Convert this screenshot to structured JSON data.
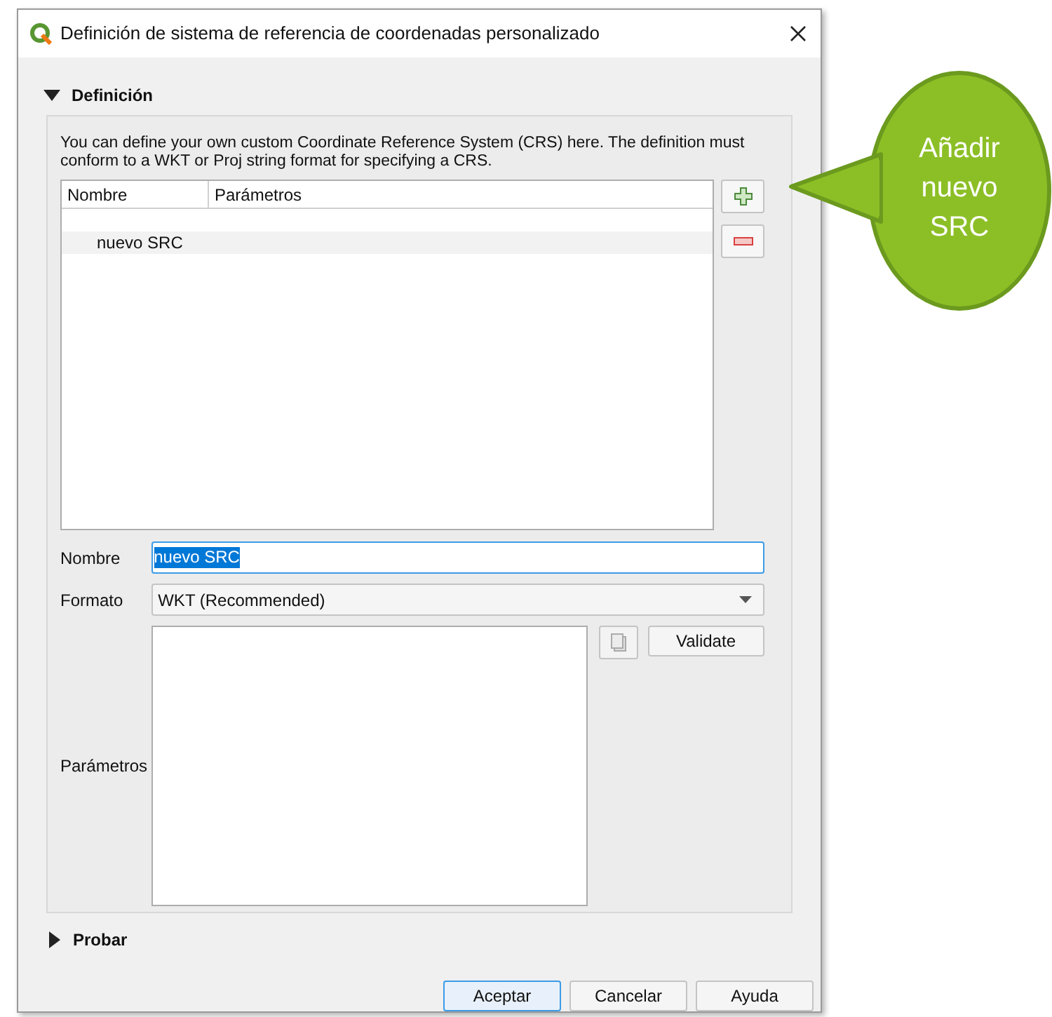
{
  "window": {
    "title": "Definición de sistema de referencia de coordenadas personalizado"
  },
  "sections": [
    {
      "title": "Definición",
      "expanded": true
    },
    {
      "title": "Probar",
      "expanded": false
    }
  ],
  "description": "You can define your own custom Coordinate Reference System (CRS) here. The definition must conform to a WKT or Proj string format for specifying a CRS.",
  "table": {
    "columns": [
      "Nombre",
      "Parámetros"
    ],
    "rows": [
      {
        "name": "nuevo SRC"
      }
    ]
  },
  "form": {
    "name_label": "Nombre",
    "name_value": "nuevo SRC",
    "format_label": "Formato",
    "format_value": "WKT (Recommended)",
    "parameters_label": "Parámetros",
    "validate": "Validate"
  },
  "buttons": [
    {
      "label": "Aceptar",
      "default": true
    },
    {
      "label": "Cancelar",
      "default": false
    },
    {
      "label": "Ayuda",
      "default": false
    }
  ],
  "callout": {
    "lines": [
      "Añadir",
      "nuevo",
      "SRC"
    ]
  }
}
